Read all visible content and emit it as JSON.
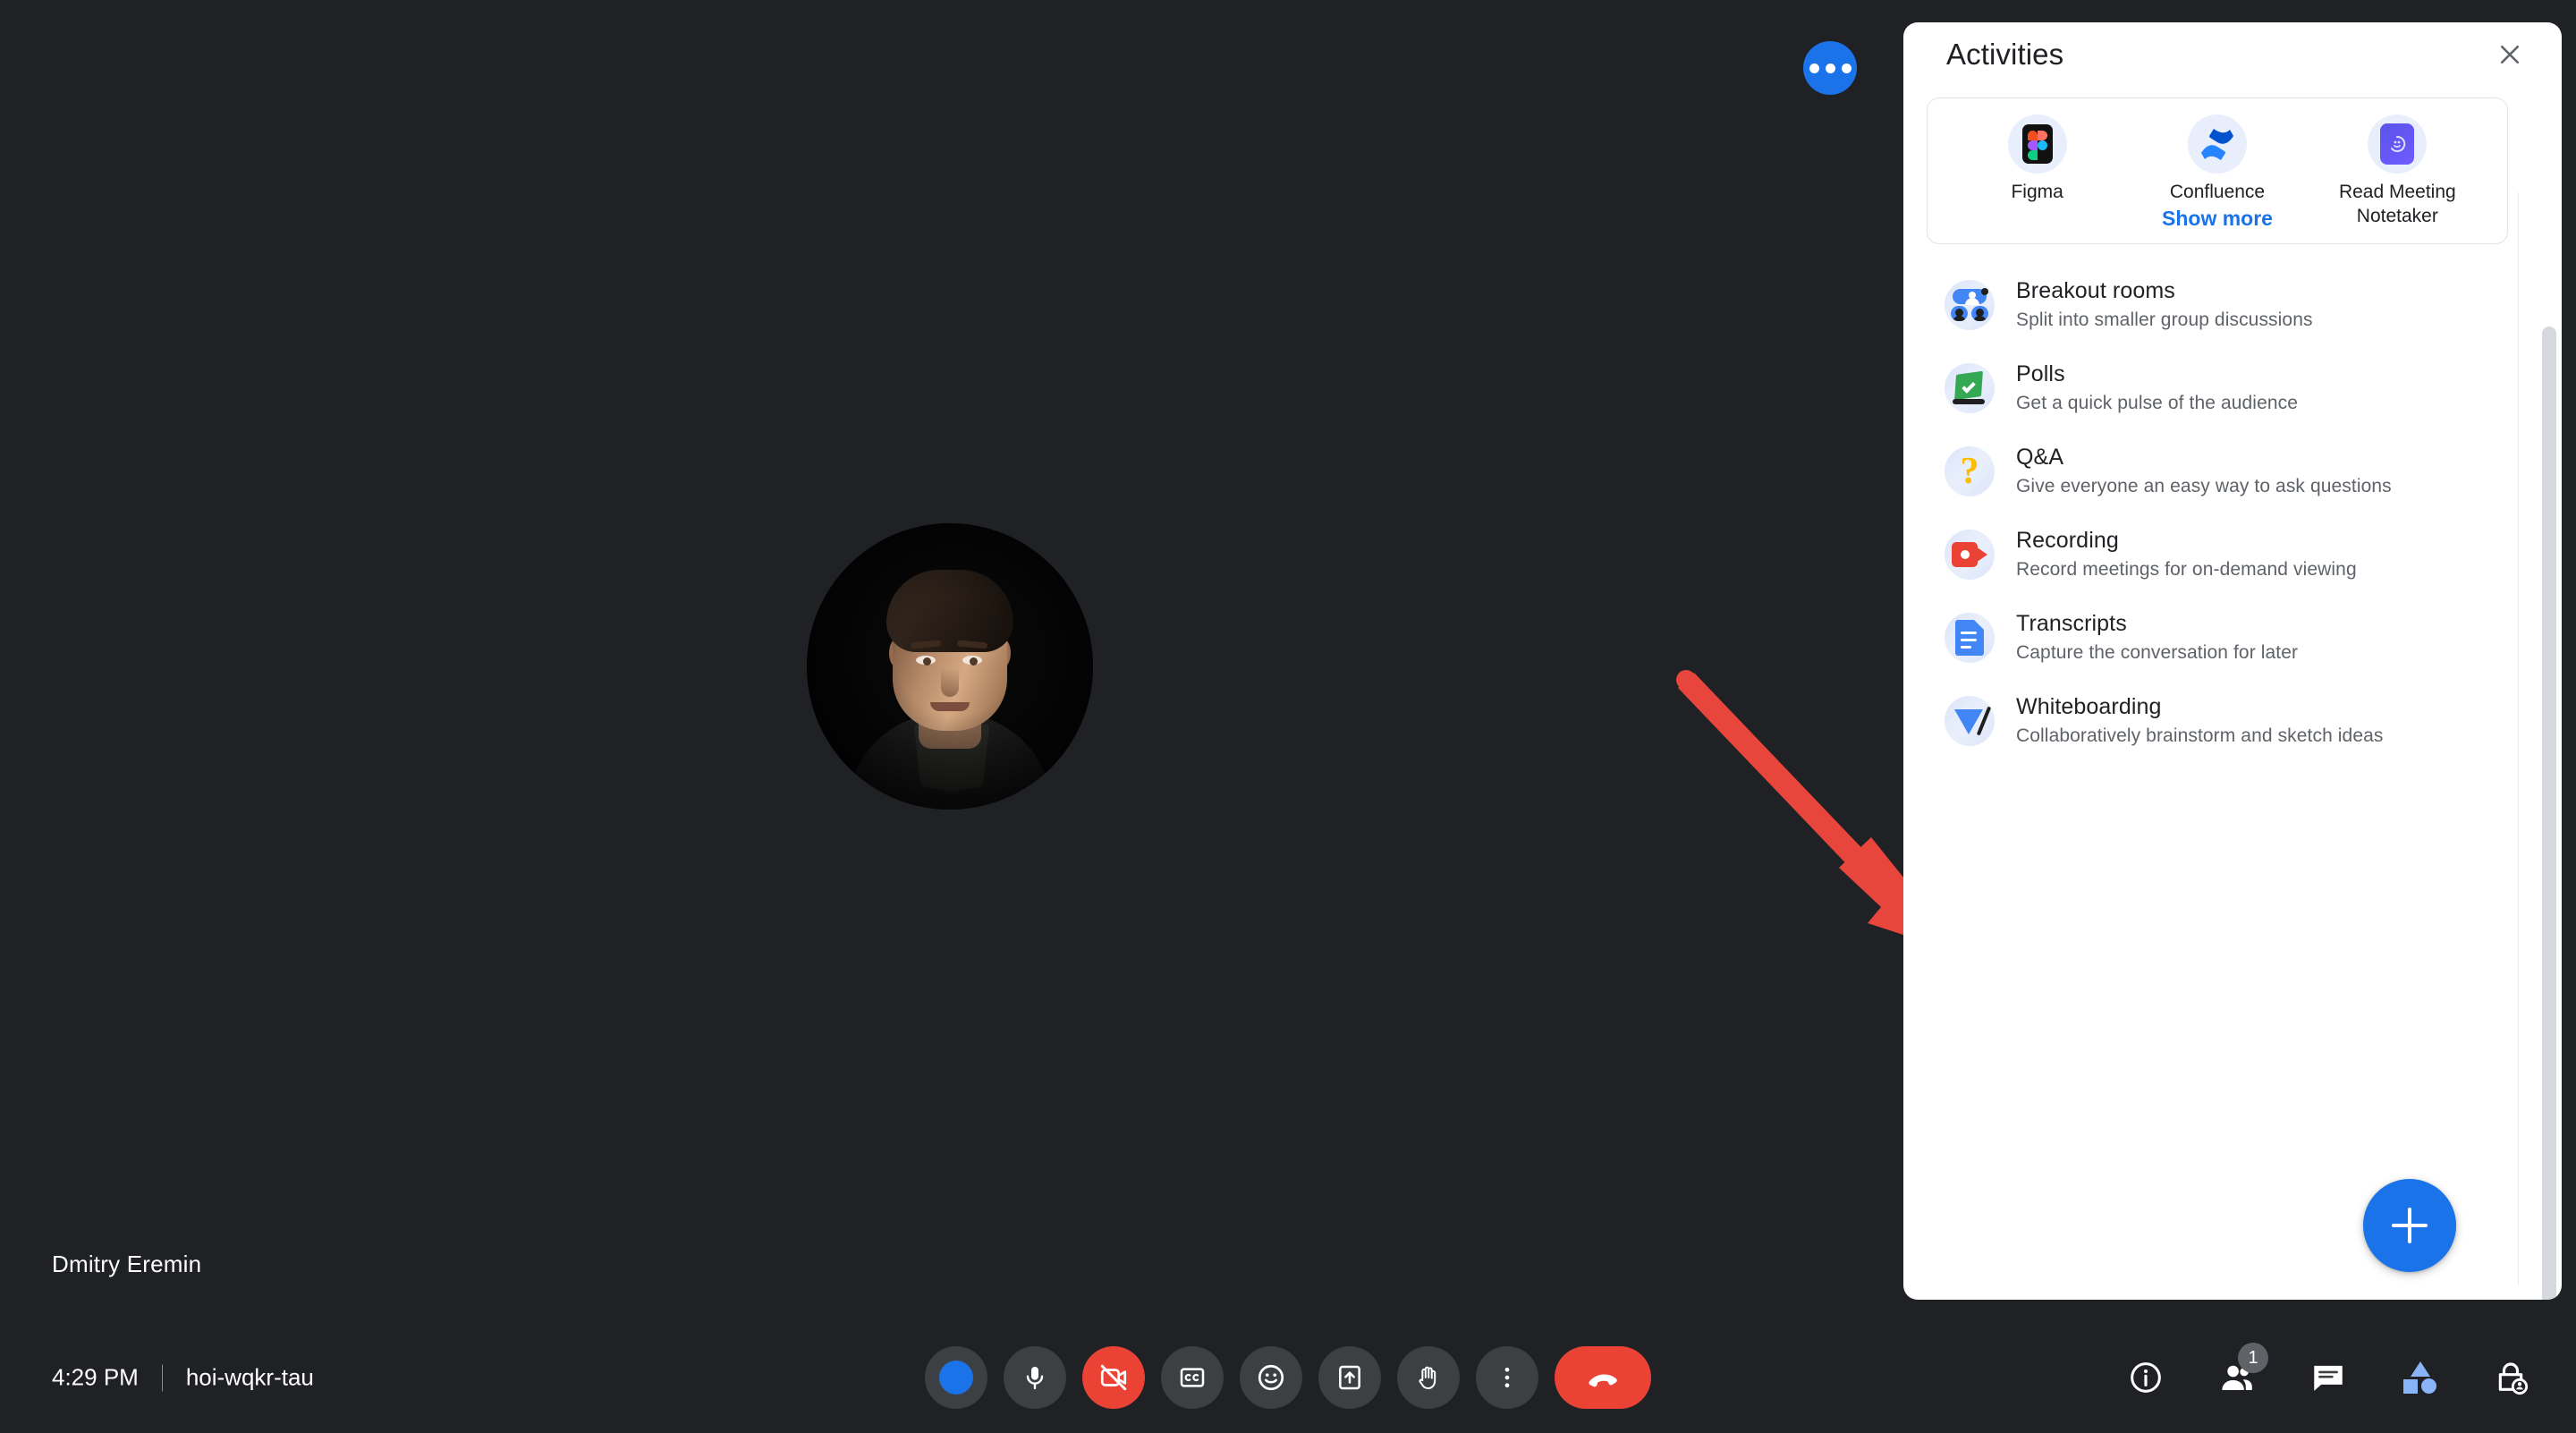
{
  "meeting": {
    "participant_name": "Dmitry Eremin",
    "time": "4:29 PM",
    "meeting_code": "hoi-wqkr-tau"
  },
  "overlay": {
    "more_options_icon": "more-horizontal-icon"
  },
  "panel": {
    "title": "Activities",
    "close_icon": "close-icon",
    "apps": [
      {
        "label": "Figma",
        "icon": "figma-icon"
      },
      {
        "label": "Confluence",
        "icon": "confluence-icon"
      },
      {
        "label": "Read Meeting Notetaker",
        "icon": "read-meeting-notetaker-icon"
      }
    ],
    "show_more_label": "Show more",
    "activities": [
      {
        "title": "Breakout rooms",
        "subtitle": "Split into smaller group discussions",
        "icon": "breakout-rooms-icon"
      },
      {
        "title": "Polls",
        "subtitle": "Get a quick pulse of the audience",
        "icon": "polls-icon"
      },
      {
        "title": "Q&A",
        "subtitle": "Give everyone an easy way to ask questions",
        "icon": "qa-icon"
      },
      {
        "title": "Recording",
        "subtitle": "Record meetings for on-demand viewing",
        "icon": "recording-icon"
      },
      {
        "title": "Transcripts",
        "subtitle": "Capture the conversation for later",
        "icon": "transcripts-icon"
      },
      {
        "title": "Whiteboarding",
        "subtitle": "Collaboratively brainstorm and sketch ideas",
        "icon": "whiteboarding-icon"
      }
    ],
    "fab_icon": "plus-icon"
  },
  "toolbar": {
    "buttons": [
      {
        "name": "reactions-blue-dot",
        "icon": "blue-circle-icon",
        "state": "default"
      },
      {
        "name": "microphone",
        "icon": "microphone-icon",
        "state": "default"
      },
      {
        "name": "camera",
        "icon": "camera-off-icon",
        "state": "off"
      },
      {
        "name": "captions",
        "icon": "closed-captions-icon",
        "state": "default"
      },
      {
        "name": "emoji-reactions",
        "icon": "smiley-icon",
        "state": "default"
      },
      {
        "name": "present-screen",
        "icon": "present-up-arrow-icon",
        "state": "default"
      },
      {
        "name": "raise-hand",
        "icon": "hand-icon",
        "state": "default"
      },
      {
        "name": "more-options",
        "icon": "more-vertical-icon",
        "state": "default"
      },
      {
        "name": "leave-call",
        "icon": "hangup-icon",
        "state": "danger"
      }
    ],
    "right_buttons": [
      {
        "name": "meeting-details",
        "icon": "info-icon",
        "badge": ""
      },
      {
        "name": "people",
        "icon": "people-icon",
        "badge": "1"
      },
      {
        "name": "chat",
        "icon": "chat-icon",
        "badge": ""
      },
      {
        "name": "activities",
        "icon": "activities-shapes-icon",
        "badge": ""
      },
      {
        "name": "host-controls",
        "icon": "lock-person-icon",
        "badge": ""
      }
    ]
  },
  "annotation": {
    "arrow_color": "#e8453c",
    "points_to": "Transcripts"
  },
  "colors": {
    "accent": "#1a73e8",
    "danger": "#ea4335",
    "background": "#202124",
    "panel_background": "#ffffff",
    "link": "#1a73e8"
  }
}
